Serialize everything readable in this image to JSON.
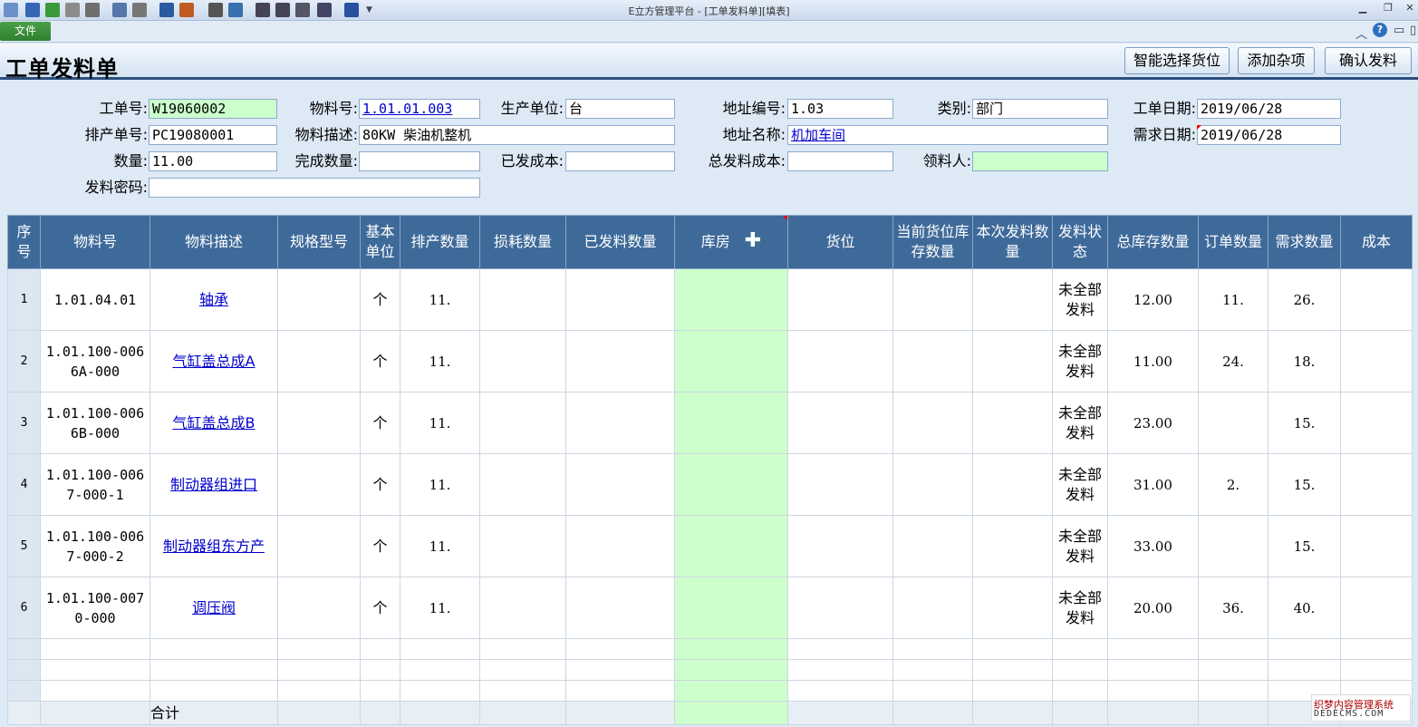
{
  "window": {
    "title": "E立方管理平台 - [工单发料单][填表]"
  },
  "menu": {
    "file": "文件"
  },
  "toolbar_icons": [
    "new-icon",
    "save-icon",
    "save-as-icon",
    "print-preview-icon",
    "print-icon",
    "copy-icon",
    "paste-icon",
    "formula-icon",
    "formula-check-icon",
    "calculator-icon",
    "chart-icon",
    "align-left-icon",
    "align-right-icon",
    "list-icon",
    "bars-icon",
    "book-icon",
    "dropdown-icon"
  ],
  "form": {
    "title": "工单发料单",
    "buttons": {
      "smart_select": "智能选择货位",
      "add_misc": "添加杂项",
      "confirm": "确认发料"
    },
    "fields": {
      "work_order_no": {
        "label": "工单号:",
        "value": "W19060002"
      },
      "material_no": {
        "label": "物料号:",
        "value": "1.01.01.003"
      },
      "production_unit": {
        "label": "生产单位:",
        "value": "台"
      },
      "address_code": {
        "label": "地址编号:",
        "value": "1.03"
      },
      "category": {
        "label": "类别:",
        "value": "部门"
      },
      "work_order_date": {
        "label": "工单日期:",
        "value": "2019/06/28"
      },
      "schedule_no": {
        "label": "排产单号:",
        "value": "PC19080001"
      },
      "material_desc": {
        "label": "物料描述:",
        "value": "80KW 柴油机整机"
      },
      "address_name": {
        "label": "地址名称:",
        "value": "机加车间"
      },
      "demand_date": {
        "label": "需求日期:",
        "value": "2019/06/28"
      },
      "quantity": {
        "label": "数量:",
        "value": "11.00"
      },
      "completed_qty": {
        "label": "完成数量:",
        "value": ""
      },
      "issued_cost": {
        "label": "已发成本:",
        "value": ""
      },
      "total_issue_cost": {
        "label": "总发料成本:",
        "value": ""
      },
      "receiver": {
        "label": "领料人:",
        "value": ""
      },
      "issue_password": {
        "label": "发料密码:",
        "value": ""
      }
    }
  },
  "grid": {
    "columns": [
      "序号",
      "物料号",
      "物料描述",
      "规格型号",
      "基本单位",
      "排产数量",
      "损耗数量",
      "已发料数量",
      "库房",
      "货位",
      "当前货位库存数量",
      "本次发料数量",
      "发料状态",
      "总库存数量",
      "订单数量",
      "需求数量",
      "成本"
    ],
    "rows": [
      {
        "idx": "1",
        "material": "1.01.04.01",
        "desc": "轴承",
        "spec": "",
        "unit": "个",
        "sched": "11.",
        "loss": "",
        "issued": "",
        "warehouse": "",
        "location": "",
        "loc_stock": "",
        "this_issue": "",
        "status": "未全部发料",
        "total_stock": "12.00",
        "order": "11.",
        "demand": "26.",
        "cost": ""
      },
      {
        "idx": "2",
        "material": "1.01.100-0066A-000",
        "desc": "气缸盖总成A",
        "spec": "",
        "unit": "个",
        "sched": "11.",
        "loss": "",
        "issued": "",
        "warehouse": "",
        "location": "",
        "loc_stock": "",
        "this_issue": "",
        "status": "未全部发料",
        "total_stock": "11.00",
        "order": "24.",
        "demand": "18.",
        "cost": ""
      },
      {
        "idx": "3",
        "material": "1.01.100-0066B-000",
        "desc": "气缸盖总成B",
        "spec": "",
        "unit": "个",
        "sched": "11.",
        "loss": "",
        "issued": "",
        "warehouse": "",
        "location": "",
        "loc_stock": "",
        "this_issue": "",
        "status": "未全部发料",
        "total_stock": "23.00",
        "order": "",
        "demand": "15.",
        "cost": ""
      },
      {
        "idx": "4",
        "material": "1.01.100-0067-000-1",
        "desc": "制动器组进口",
        "spec": "",
        "unit": "个",
        "sched": "11.",
        "loss": "",
        "issued": "",
        "warehouse": "",
        "location": "",
        "loc_stock": "",
        "this_issue": "",
        "status": "未全部发料",
        "total_stock": "31.00",
        "order": "2.",
        "demand": "15.",
        "cost": ""
      },
      {
        "idx": "5",
        "material": "1.01.100-0067-000-2",
        "desc": "制动器组东方产",
        "spec": "",
        "unit": "个",
        "sched": "11.",
        "loss": "",
        "issued": "",
        "warehouse": "",
        "location": "",
        "loc_stock": "",
        "this_issue": "",
        "status": "未全部发料",
        "total_stock": "33.00",
        "order": "",
        "demand": "15.",
        "cost": ""
      },
      {
        "idx": "6",
        "material": "1.01.100-0070-000",
        "desc": "调压阀",
        "spec": "",
        "unit": "个",
        "sched": "11.",
        "loss": "",
        "issued": "",
        "warehouse": "",
        "location": "",
        "loc_stock": "",
        "this_issue": "",
        "status": "未全部发料",
        "total_stock": "20.00",
        "order": "36.",
        "demand": "40.",
        "cost": ""
      }
    ],
    "total_label": "合计"
  },
  "watermark": {
    "line1": "织梦内容管理系统",
    "line2": "DEDECMS.COM"
  }
}
